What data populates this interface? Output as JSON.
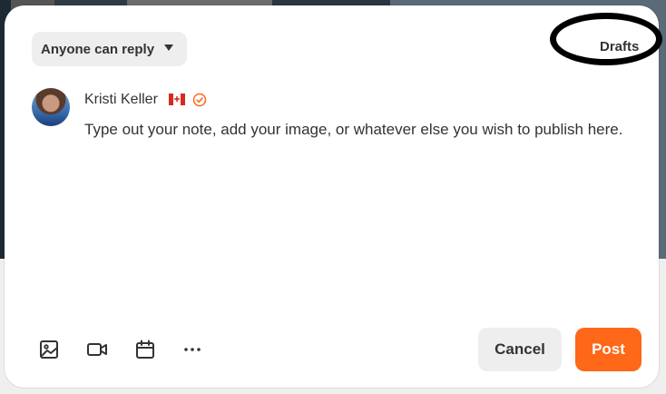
{
  "composer": {
    "reply_setting": "Anyone can reply",
    "drafts_label": "Drafts",
    "author_name": "Kristi Keller",
    "author_flag": "canada-flag-icon",
    "verified_icon": "verified-check-icon",
    "placeholder": "Type out your note, add your image, or whatever else you wish to publish here."
  },
  "toolbar": {
    "icons": [
      "image-icon",
      "video-icon",
      "calendar-icon",
      "more-icon"
    ],
    "cancel_label": "Cancel",
    "post_label": "Post"
  },
  "colors": {
    "accent": "#ff6719",
    "button_gray": "#eeeeee",
    "text": "#333333"
  }
}
